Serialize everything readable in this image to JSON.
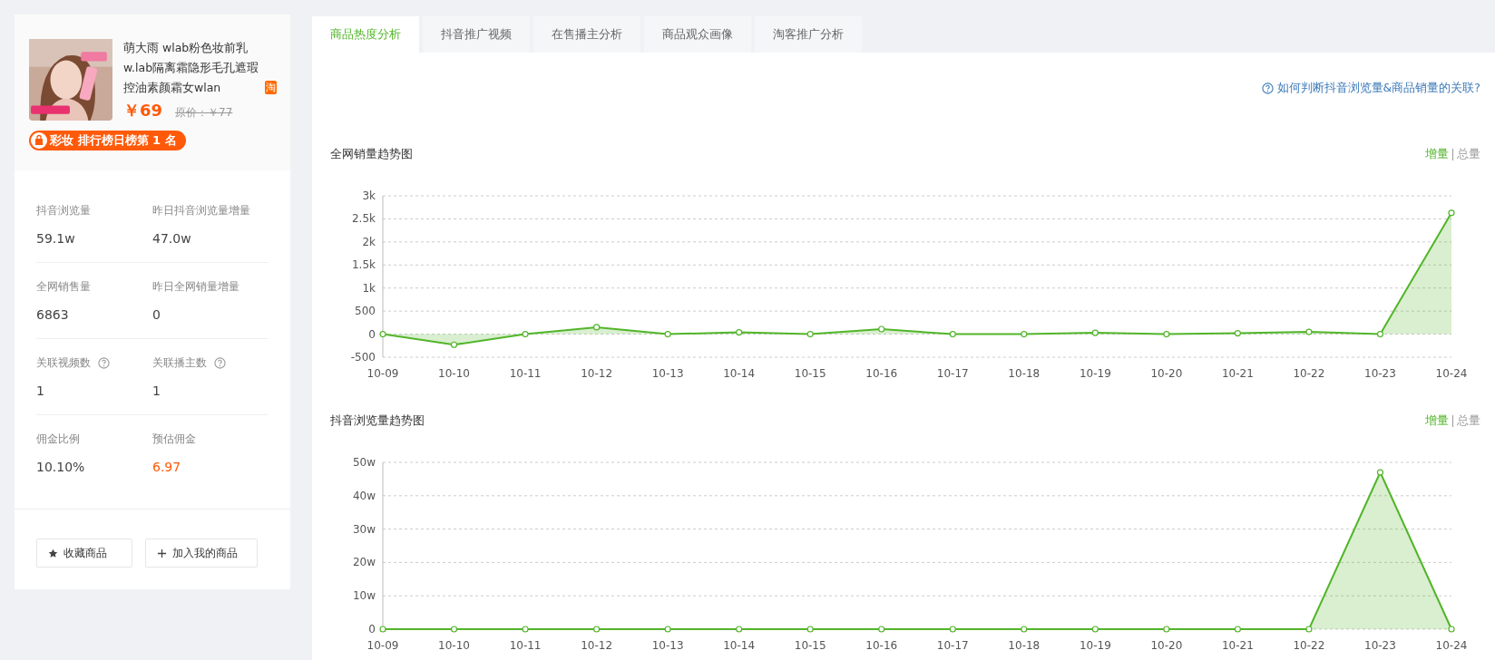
{
  "product": {
    "title": "萌大雨 wlab粉色妆前乳w.lab隔离霜隐形毛孔遮瑕控油素颜霜女wlan",
    "shop_badge": "淘",
    "price": "￥69",
    "original_price": "原价：￥77",
    "rank_badge": "彩妆 排行榜日榜第 1 名"
  },
  "stats": [
    {
      "label": "抖音浏览量",
      "value": "59.1w",
      "help": false,
      "accent": false
    },
    {
      "label": "昨日抖音浏览量增量",
      "value": "47.0w",
      "help": false,
      "accent": false
    },
    {
      "label": "全网销售量",
      "value": "6863",
      "help": false,
      "accent": false
    },
    {
      "label": "昨日全网销量增量",
      "value": "0",
      "help": false,
      "accent": false
    },
    {
      "label": "关联视频数",
      "value": "1",
      "help": true,
      "accent": false
    },
    {
      "label": "关联播主数",
      "value": "1",
      "help": true,
      "accent": false
    },
    {
      "label": "佣金比例",
      "value": "10.10%",
      "help": false,
      "accent": false
    },
    {
      "label": "预估佣金",
      "value": "6.97",
      "help": false,
      "accent": true
    }
  ],
  "actions": [
    {
      "label": "收藏商品",
      "kind": "favorite"
    },
    {
      "label": "加入我的商品",
      "kind": "add"
    }
  ],
  "tabs": [
    {
      "label": "商品热度分析",
      "selected": true
    },
    {
      "label": "抖音推广视频",
      "selected": false
    },
    {
      "label": "在售播主分析",
      "selected": false
    },
    {
      "label": "商品观众画像",
      "selected": false
    },
    {
      "label": "淘客推广分析",
      "selected": false
    }
  ],
  "help_link": "如何判断抖音浏览量&商品销量的关联?",
  "charts": [
    {
      "title": "全网销量趋势图",
      "toggle": [
        {
          "label": "增量",
          "selected": true
        },
        {
          "label": "总量",
          "selected": false
        }
      ],
      "chart_data": {
        "type": "area",
        "grid": true,
        "categories": [
          "10-09",
          "10-10",
          "10-11",
          "10-12",
          "10-13",
          "10-14",
          "10-15",
          "10-16",
          "10-17",
          "10-18",
          "10-19",
          "10-20",
          "10-21",
          "10-22",
          "10-23",
          "10-24"
        ],
        "series": [
          {
            "color": "#52b52a",
            "values": [
              0,
              -230,
              0,
              150,
              0,
              40,
              0,
              110,
              0,
              0,
              30,
              0,
              20,
              50,
              0,
              2630
            ]
          }
        ],
        "ylim": [
          -500,
          3000
        ],
        "yticks": [
          {
            "value": -500,
            "label": "-500"
          },
          {
            "value": 0,
            "label": "0"
          },
          {
            "value": 500,
            "label": "500"
          },
          {
            "value": 1000,
            "label": "1k"
          },
          {
            "value": 1500,
            "label": "1.5k"
          },
          {
            "value": 2000,
            "label": "2k"
          },
          {
            "value": 2500,
            "label": "2.5k"
          },
          {
            "value": 3000,
            "label": "3k"
          }
        ]
      }
    },
    {
      "title": "抖音浏览量趋势图",
      "toggle": [
        {
          "label": "增量",
          "selected": true
        },
        {
          "label": "总量",
          "selected": false
        }
      ],
      "chart_data": {
        "type": "area",
        "grid": true,
        "categories": [
          "10-09",
          "10-10",
          "10-11",
          "10-12",
          "10-13",
          "10-14",
          "10-15",
          "10-16",
          "10-17",
          "10-18",
          "10-19",
          "10-20",
          "10-21",
          "10-22",
          "10-23",
          "10-24"
        ],
        "series": [
          {
            "color": "#52b52a",
            "values": [
              0,
              0,
              0,
              0,
              0,
              0,
              0,
              0,
              0,
              0,
              0,
              0,
              0,
              0,
              47,
              0
            ]
          }
        ],
        "ylim": [
          0,
          50
        ],
        "yticks": [
          {
            "value": 0,
            "label": "0"
          },
          {
            "value": 10,
            "label": "10w"
          },
          {
            "value": 20,
            "label": "20w"
          },
          {
            "value": 30,
            "label": "30w"
          },
          {
            "value": 40,
            "label": "40w"
          },
          {
            "value": 50,
            "label": "50w"
          }
        ]
      }
    }
  ]
}
